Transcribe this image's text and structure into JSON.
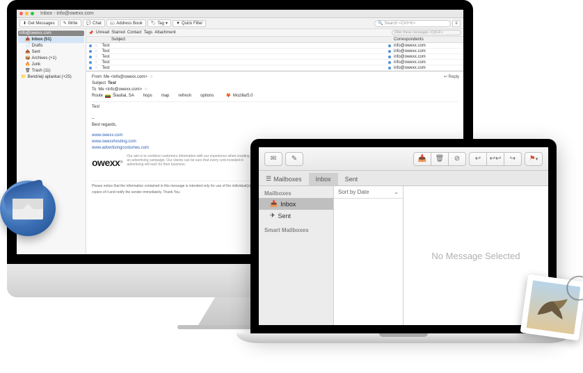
{
  "thunderbird": {
    "titlebar": {
      "title": "Inbox - info@owexx.com"
    },
    "toolbar": {
      "get_messages": "Get Messages",
      "write": "Write",
      "chat": "Chat",
      "address_book": "Address Book",
      "tag": "Tag",
      "quick_filter": "Quick Filter",
      "search_placeholder": "Search <Ctrl+K>"
    },
    "sidebar": {
      "account": "info@owexx.com",
      "folders": [
        {
          "label": "Inbox (51)",
          "selected": true
        },
        {
          "label": "Drafts",
          "selected": false
        },
        {
          "label": "Sent",
          "selected": false
        },
        {
          "label": "Archives (+1)",
          "selected": false
        },
        {
          "label": "Junk",
          "selected": false
        },
        {
          "label": "Trash (11)",
          "selected": false
        },
        {
          "label": "Bendrieji aplankai (+25)",
          "selected": false
        }
      ]
    },
    "filterbar": {
      "unread": "Unread",
      "starred": "Starred",
      "contact": "Contact",
      "tags": "Tags",
      "attachment": "Attachment",
      "filter_placeholder": "Filter these messages <Ctrl+F>"
    },
    "list": {
      "col_subject": "Subject",
      "col_correspondents": "Correspondents",
      "rows": [
        {
          "subject": "Test",
          "correspondent": "info@owexx.com"
        },
        {
          "subject": "Test",
          "correspondent": "info@owexx.com"
        },
        {
          "subject": "Test",
          "correspondent": "info@owexx.com"
        },
        {
          "subject": "Test",
          "correspondent": "info@owexx.com"
        },
        {
          "subject": "Test",
          "correspondent": "info@owexx.com"
        }
      ]
    },
    "message": {
      "from_label": "From",
      "from_value": "Me <info@owexx.com>",
      "subject_label": "Subject",
      "subject_value": "Test",
      "to_label": "To",
      "to_value": "Me <info@owexx.com>",
      "route_label": "Route",
      "route_value": "Šiauliai, SA",
      "hops": "hops",
      "map": "map",
      "refresh": "refresh",
      "options": "options",
      "agent": "Mozilla/5.0",
      "reply": "Reply",
      "body_greeting": "Test",
      "body_regards": "Best regards,",
      "links": [
        "www.owexx.com",
        "www.owexxhosting.com",
        "www.advertisingcostumes.com"
      ],
      "brand": "owexx",
      "tagline": "Our aim is to combine customers information with our experience when creating an advertising campaign. Our clients can be sure that every cent invested in advertising will earn for their business.",
      "disclaimer": "Please notice that the information contained in this message is intended only for use of the individual(s) named above and contains information that may be privileged. If you have received this message in error please delete it and any copies of it and notify the sender immediately. Thank You."
    }
  },
  "applemail": {
    "tabs": {
      "mailboxes": "Mailboxes",
      "inbox": "Inbox",
      "sent": "Sent"
    },
    "sidebar": {
      "section_mailboxes": "Mailboxes",
      "inbox": "Inbox",
      "sent": "Sent",
      "section_smart": "Smart Mailboxes"
    },
    "list": {
      "sort": "Sort by Date"
    },
    "preview": {
      "empty": "No Message Selected"
    }
  }
}
